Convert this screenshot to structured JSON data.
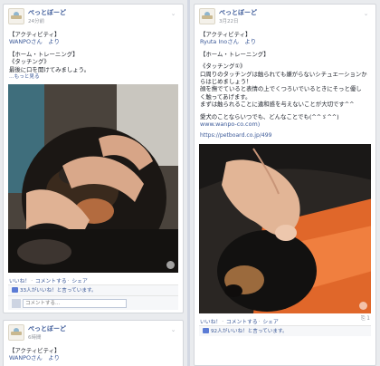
{
  "colors": {
    "link": "#3b5998",
    "muted": "#90949c",
    "background": "#e9ebee"
  },
  "page_name": "ぺっとぼーど",
  "posts": [
    {
      "date": "24分前",
      "lines": [
        "【アクティビティ】",
        "WANPOさん　より",
        "",
        "【ホーム・トレーニング】",
        "《タッチング》",
        "最後に口を開けてみましょう。"
      ],
      "more": "…もっと見る",
      "photo_subject": "hands-opening-dog-mouth",
      "like": "いいね！",
      "comment": "コメントする",
      "share": "シェア",
      "likes_text": "33人がいいね！と言っています。",
      "comment_placeholder": "コメントする..."
    },
    {
      "date": "3月22日",
      "lines": [
        "【アクティビティ】",
        "Ryuta Inoさん　より",
        "",
        "【ホーム・トレーニング】",
        "",
        "《タッチング①》",
        "口周りのタッチングは触られても嫌がらないシチュエーションか",
        "らはじめましょう！",
        "顔を撫でていると表情の上でくつろいでいるときにそっと優し",
        "く触ってあげます。",
        "まずは触られることに違和感を与えないことが大切です^^",
        "",
        "愛犬のことならいつでも、どんなことでも(^^ゞ^^)",
        "www.wanpo-co.com)",
        ""
      ],
      "url": "https://petboard.co.jp/499",
      "photo_subject": "hand-touching-dog-mouth",
      "like": "いいね！",
      "comment": "コメントする",
      "share": "シェア",
      "share_count": "1",
      "likes_text": "92人がいいね！と言っています。"
    },
    {
      "date": "6時間",
      "lines": [
        "【アクティビティ】",
        "WANPOさん　より"
      ]
    }
  ]
}
